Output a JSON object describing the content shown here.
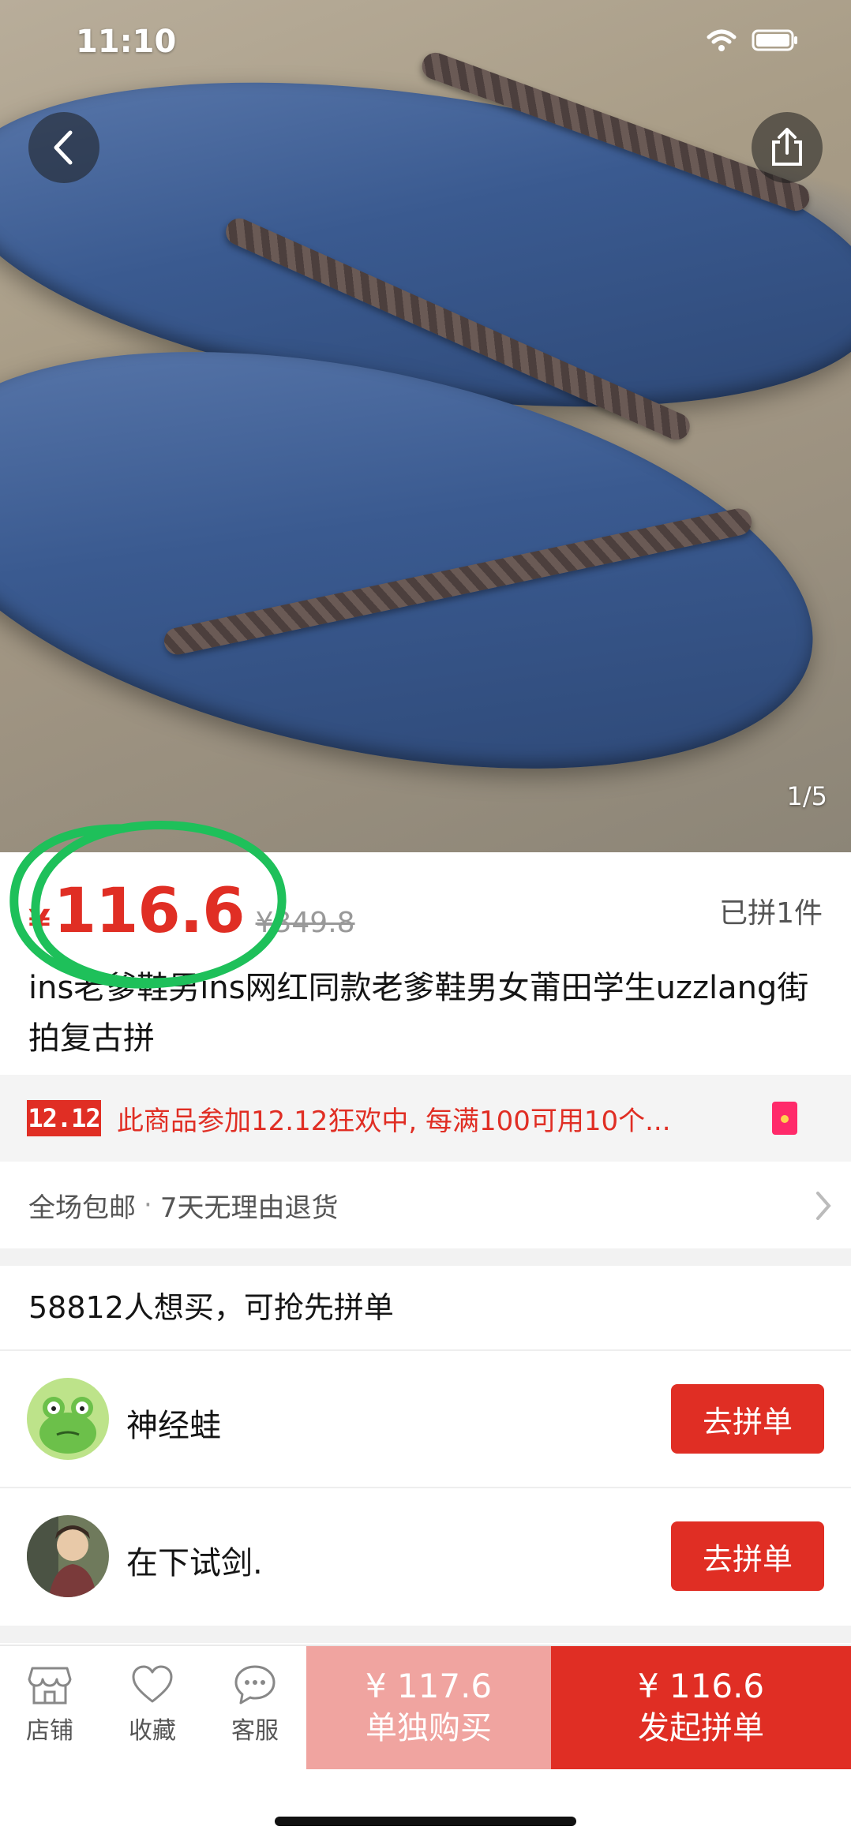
{
  "status_bar": {
    "time": "11:10"
  },
  "gallery": {
    "counter": "1/5"
  },
  "price": {
    "currency": "¥",
    "current": "116.6",
    "original": "¥349.8",
    "sold": "已拼1件"
  },
  "product": {
    "title": "ins老爹鞋男ins网红同款老爹鞋男女莆田学生uzzlang街拍复古拼"
  },
  "promo": {
    "badge": "12.12",
    "text": "此商品参加12.12狂欢中, 每满100可用10个..."
  },
  "service": {
    "item1": "全场包邮",
    "dot": "·",
    "item2": "7天无理由退货"
  },
  "group_buy": {
    "want_text": "58812人想买，可抢先拼单",
    "rows": [
      {
        "name": "神经蛙",
        "button": "去拼单"
      },
      {
        "name": "在下试剑.",
        "button": "去拼单"
      }
    ]
  },
  "bottom_bar": {
    "store_label": "店铺",
    "favorite_label": "收藏",
    "service_label": "客服",
    "buy_alone_price": "¥ 117.6",
    "buy_alone_label": "单独购买",
    "buy_group_price": "¥ 116.6",
    "buy_group_label": "发起拼单"
  },
  "colors": {
    "accent": "#e02e24",
    "accent_light": "#f0a4a0",
    "annotation": "#1ec05a"
  }
}
